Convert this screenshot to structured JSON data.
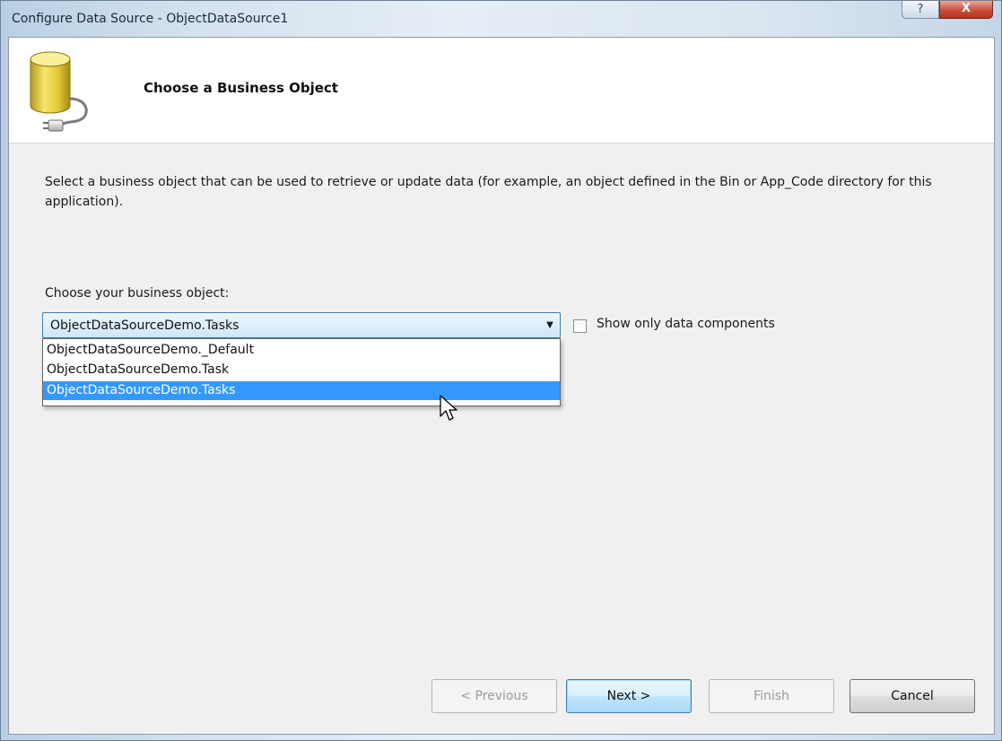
{
  "window": {
    "title": "Configure Data Source - ObjectDataSource1",
    "help_label": "?",
    "close_label": "X"
  },
  "header": {
    "title": "Choose a Business Object"
  },
  "description": "Select a business object that can be used to retrieve or update data (for example, an object defined in the Bin or App_Code directory for this application).",
  "business_object": {
    "label": "Choose your business object:",
    "selected_value": "ObjectDataSourceDemo.Tasks",
    "options": [
      "ObjectDataSourceDemo._Default",
      "ObjectDataSourceDemo.Task",
      "ObjectDataSourceDemo.Tasks"
    ],
    "highlighted_index": 2
  },
  "show_only_data_components": {
    "label": "Show only data components",
    "checked": false
  },
  "buttons": {
    "previous": "< Previous",
    "next": "Next >",
    "finish": "Finish",
    "cancel": "Cancel"
  },
  "icons": {
    "header_icon": "database-connector-icon",
    "dropdown_arrow": "chevron-down-icon",
    "cursor": "mouse-pointer-icon"
  }
}
